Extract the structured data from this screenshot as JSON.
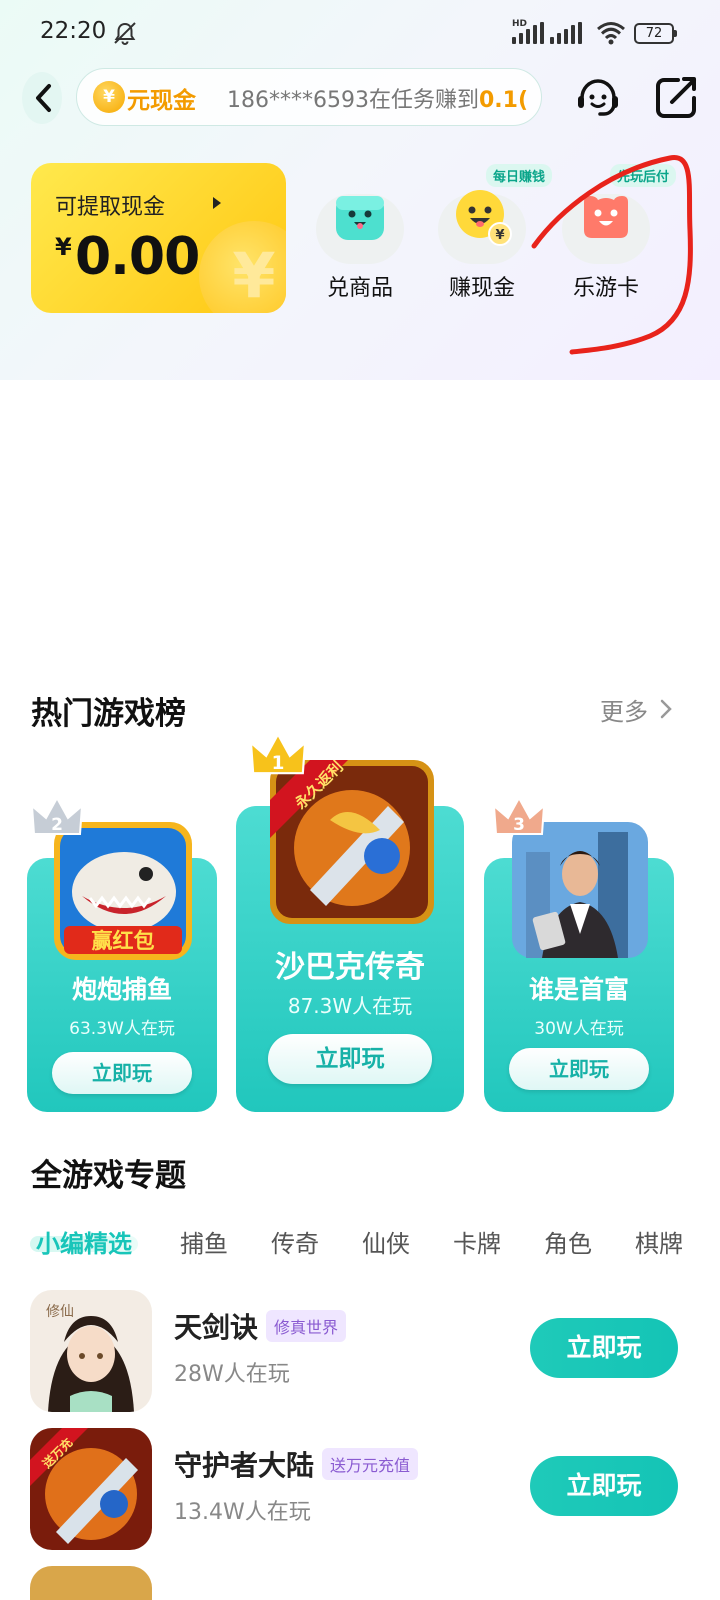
{
  "status_bar": {
    "time": "22:20",
    "hd": "HD",
    "battery": "72"
  },
  "header": {
    "ticker_tag": "元现金",
    "ticker_coin": "¥",
    "ticker_message": "186****6593在任务赚到",
    "ticker_amount": "0.1("
  },
  "cash_card": {
    "label": "可提取现金",
    "currency": "¥",
    "amount": "0.00",
    "coin": "¥"
  },
  "quick_actions": [
    {
      "label": "兑商品",
      "badge": ""
    },
    {
      "label": "赚现金",
      "badge": "每日赚钱"
    },
    {
      "label": "乐游卡",
      "badge": "先玩后付"
    }
  ],
  "hot_games": {
    "title": "热门游戏榜",
    "more": "更多",
    "cards": [
      {
        "rank": "2",
        "name": "炮炮捕鱼",
        "players": "63.3W人在玩",
        "button": "立即玩",
        "icon_text": "赢红包"
      },
      {
        "rank": "1",
        "name": "沙巴克传奇",
        "players": "87.3W人在玩",
        "button": "立即玩",
        "icon_text": "永久返利"
      },
      {
        "rank": "3",
        "name": "谁是首富",
        "players": "30W人在玩",
        "button": "立即玩",
        "icon_text": ""
      }
    ]
  },
  "all_games": {
    "title": "全游戏专题",
    "tabs": [
      "小编精选",
      "捕鱼",
      "传奇",
      "仙侠",
      "卡牌",
      "角色",
      "棋牌"
    ],
    "active_tab": 0,
    "list": [
      {
        "name": "天剑诀",
        "tag": "修真世界",
        "players": "28W人在玩",
        "button": "立即玩",
        "icon_text": "修仙"
      },
      {
        "name": "守护者大陆",
        "tag": "送万元充值",
        "players": "13.4W人在玩",
        "button": "立即玩",
        "icon_text": "送万充"
      }
    ]
  },
  "colors": {
    "accent": "#18c5b9",
    "gold": "#f39b00",
    "annotation": "#e8231b"
  }
}
